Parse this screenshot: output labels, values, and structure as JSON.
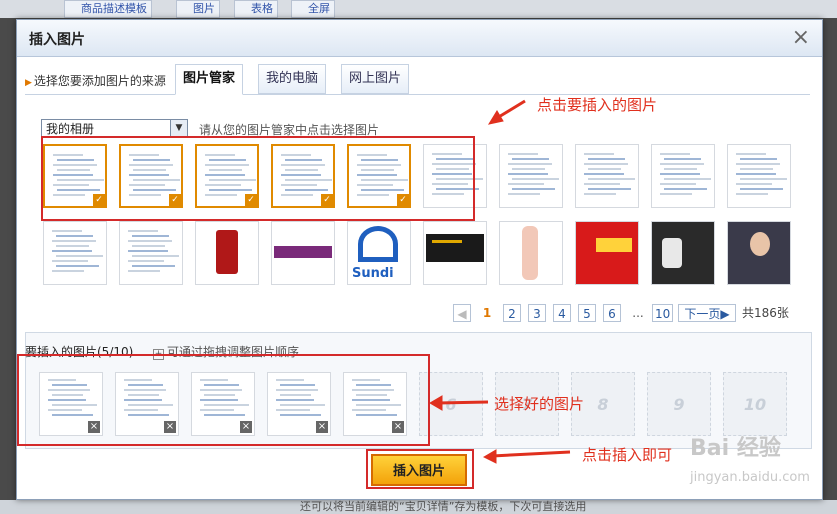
{
  "background": {
    "tabs": [
      "商品描述模板",
      "图片",
      "表格",
      "全屏"
    ],
    "bottom_text": "还可以将当前编辑的“宝贝详情”存为模板，下次可直接选用"
  },
  "dialog": {
    "title": "插入图片",
    "close_label": "×",
    "source_label": "选择您要添加图片的来源",
    "tabs": [
      "图片管家",
      "我的电脑",
      "网上图片"
    ],
    "album_select": "我的相册",
    "hint": "请从您的图片管家中点击选择图片",
    "thumbnails": [
      {
        "kind": "doc",
        "selected": true
      },
      {
        "kind": "doc",
        "selected": true
      },
      {
        "kind": "doc",
        "selected": true
      },
      {
        "kind": "doc",
        "selected": true
      },
      {
        "kind": "doc",
        "selected": true
      },
      {
        "kind": "doc",
        "selected": false
      },
      {
        "kind": "doc",
        "selected": false
      },
      {
        "kind": "doc",
        "selected": false
      },
      {
        "kind": "doc",
        "selected": false
      },
      {
        "kind": "doc",
        "selected": false
      },
      {
        "kind": "doc",
        "selected": false
      },
      {
        "kind": "doc",
        "selected": false
      },
      {
        "kind": "red-product",
        "selected": false
      },
      {
        "kind": "banner",
        "selected": false
      },
      {
        "kind": "logo",
        "text": "Sundi",
        "selected": false
      },
      {
        "kind": "dark-banner",
        "selected": false
      },
      {
        "kind": "clipper",
        "selected": false
      },
      {
        "kind": "red-ad",
        "selected": false
      },
      {
        "kind": "dark-product",
        "selected": false
      },
      {
        "kind": "portrait",
        "selected": false
      }
    ],
    "pagination": {
      "current": "1",
      "pages": [
        "2",
        "3",
        "4",
        "5",
        "6"
      ],
      "ellipsis": "...",
      "last": "10",
      "next": "下一页",
      "total": "共186张"
    },
    "insert_panel": {
      "title": "要插入的图片(5/10)",
      "hint": "可通过拖拽调整图片顺序",
      "empty_slots": [
        "6",
        "7",
        "8",
        "9",
        "10"
      ]
    },
    "insert_button": "插入图片"
  },
  "annotations": {
    "click_picture": "点击要插入的图片",
    "selected_pictures": "选择好的图片",
    "click_insert": "点击插入即可"
  },
  "watermark": {
    "logo": "Bai 经验",
    "url": "jingyan.baidu.com"
  },
  "colors": {
    "accent_orange": "#e08a00",
    "annotation_red": "#e0301e",
    "button_yellow": "#ffd23a"
  }
}
